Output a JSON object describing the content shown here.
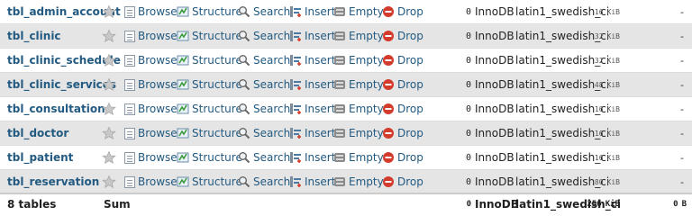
{
  "tables": [
    {
      "name": "tbl_admin_account",
      "rows": "0",
      "engine": "InnoDB",
      "collation": "latin1_swedish_ci",
      "size": "16",
      "size_unit": "KiB",
      "overhead": "-"
    },
    {
      "name": "tbl_clinic",
      "rows": "0",
      "engine": "InnoDB",
      "collation": "latin1_swedish_ci",
      "size": "32",
      "size_unit": "KiB",
      "overhead": "-"
    },
    {
      "name": "tbl_clinic_schedule",
      "rows": "0",
      "engine": "InnoDB",
      "collation": "latin1_swedish_ci",
      "size": "32",
      "size_unit": "KiB",
      "overhead": "-"
    },
    {
      "name": "tbl_clinic_services",
      "rows": "0",
      "engine": "InnoDB",
      "collation": "latin1_swedish_ci",
      "size": "48",
      "size_unit": "KiB",
      "overhead": "-"
    },
    {
      "name": "tbl_consultation",
      "rows": "0",
      "engine": "InnoDB",
      "collation": "latin1_swedish_ci",
      "size": "16",
      "size_unit": "KiB",
      "overhead": "-"
    },
    {
      "name": "tbl_doctor",
      "rows": "0",
      "engine": "InnoDB",
      "collation": "latin1_swedish_ci",
      "size": "16",
      "size_unit": "KiB",
      "overhead": "-"
    },
    {
      "name": "tbl_patient",
      "rows": "0",
      "engine": "InnoDB",
      "collation": "latin1_swedish_ci",
      "size": "16",
      "size_unit": "KiB",
      "overhead": "-"
    },
    {
      "name": "tbl_reservation",
      "rows": "0",
      "engine": "InnoDB",
      "collation": "latin1_swedish_ci",
      "size": "80",
      "size_unit": "KiB",
      "overhead": "-"
    }
  ],
  "actions": {
    "browse": "Browse",
    "structure": "Structure",
    "search": "Search",
    "insert": "Insert",
    "empty": "Empty",
    "drop": "Drop"
  },
  "footer": {
    "count": "8 tables",
    "sum": "Sum",
    "rows": "0",
    "engine": "InnoDB",
    "collation": "latin1_swedish_ci",
    "size": "256",
    "size_unit": "KiB",
    "overhead": "0",
    "overhead_unit": "B"
  },
  "icons": {
    "favorite": "star-icon",
    "browse": "browse-icon",
    "structure": "structure-icon",
    "search": "search-icon",
    "insert": "insert-icon",
    "empty": "empty-icon",
    "drop": "drop-icon"
  },
  "colors": {
    "link": "#235a81",
    "row_alt": "#e5e5e5",
    "drop": "#d33c2c"
  }
}
